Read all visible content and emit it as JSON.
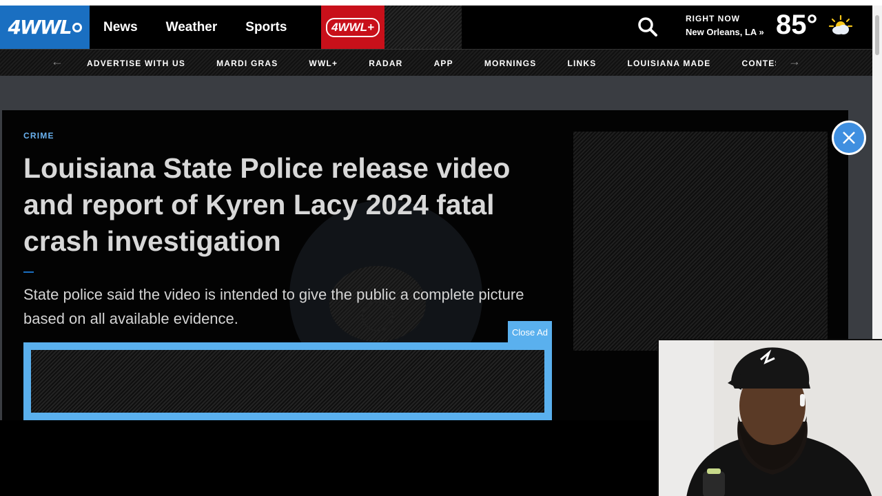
{
  "header": {
    "logo_text": "4WWL",
    "nav": [
      "News",
      "Weather",
      "Sports"
    ],
    "plus_tab": "4WWL+",
    "weather": {
      "label": "RIGHT NOW",
      "location": "New Orleans, LA »",
      "temperature": "85°"
    }
  },
  "subnav": {
    "items": [
      "ADVERTISE WITH US",
      "MARDI GRAS",
      "WWL+",
      "RADAR",
      "APP",
      "MORNINGS",
      "LINKS",
      "LOUISIANA MADE",
      "CONTESTS"
    ],
    "prev_arrow": "←",
    "next_arrow": "→"
  },
  "article": {
    "kicker": "CRIME",
    "headline": "Louisiana State Police release video and report of Kyren Lacy 2024 fatal crash investigation",
    "dek": "State police said the video is intended to give the public a complete picture based on all available evidence."
  },
  "ads": {
    "close_ad_label": "Close Ad"
  },
  "icons": {
    "search": "search-icon",
    "weather": "partly-sunny-icon",
    "close": "close-icon"
  },
  "colors": {
    "brand_blue": "#1a6fc1",
    "plus_red": "#c8101a",
    "ad_frame": "#5ab0ee",
    "kicker": "#6ab3f2"
  }
}
